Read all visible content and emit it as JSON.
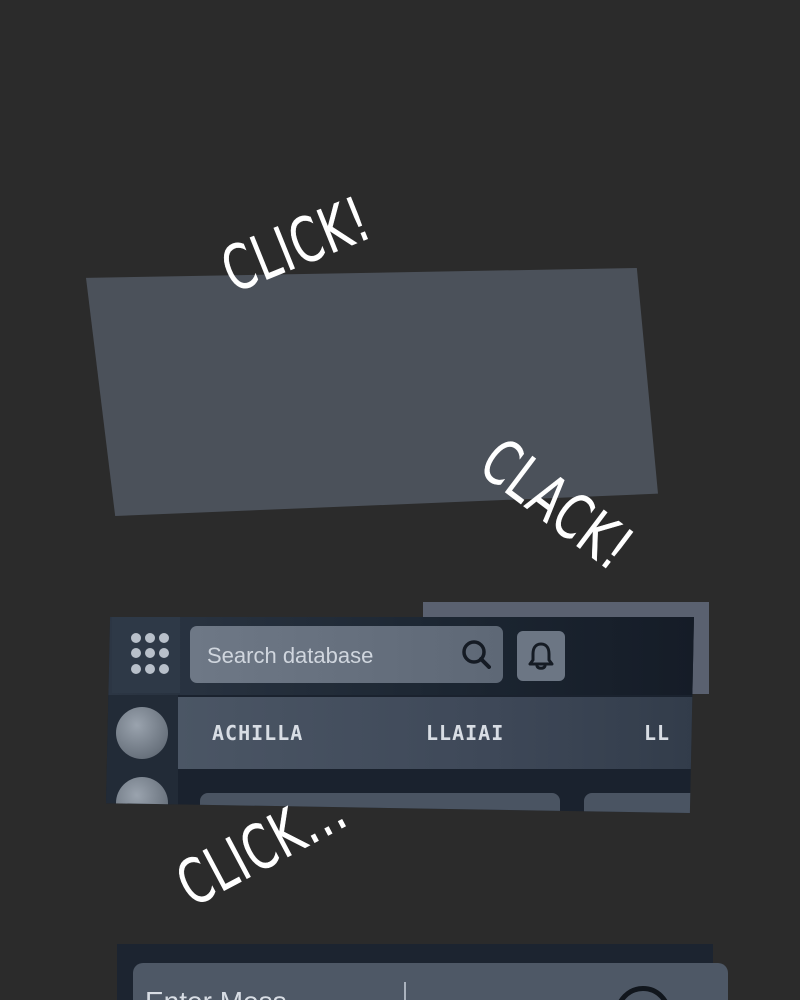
{
  "effects": {
    "first": "CLICK!",
    "second": "CLACK!",
    "third": "CLICK..."
  },
  "app_bar": {
    "menu_icon": "grid-dots-icon",
    "search": {
      "placeholder": "Search database",
      "icon": "search-icon"
    },
    "notification_icon": "bell-icon"
  },
  "rows": {
    "labels": [
      "ACHILLA",
      "LLAIAI",
      "LL"
    ]
  },
  "bottom": {
    "input_text": "Enter Mess"
  },
  "colors": {
    "background": "#2b2b2b",
    "panel": "#4b515a",
    "app_dark": "#1a222e",
    "search_fill": "#6e7886",
    "effect_text": "#ffffff"
  }
}
